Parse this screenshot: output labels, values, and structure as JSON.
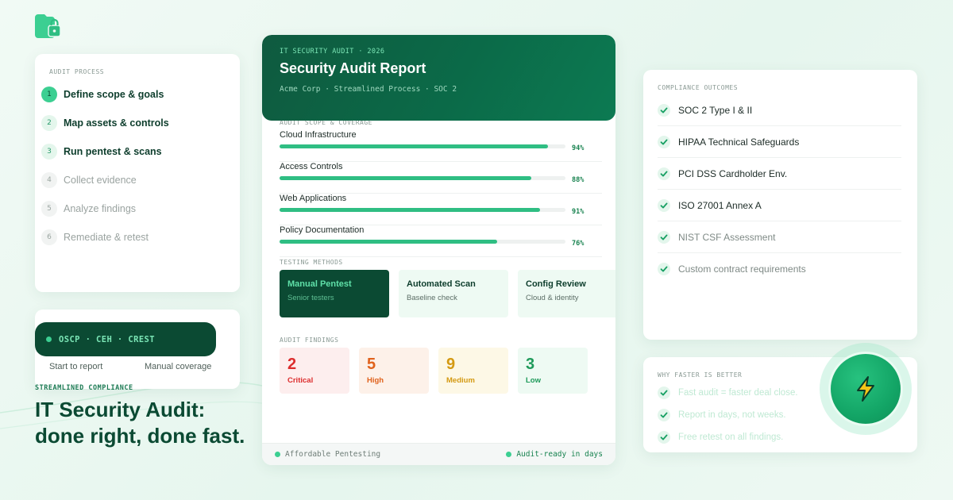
{
  "process": {
    "label": "AUDIT PROCESS",
    "steps": [
      {
        "num": "1",
        "label": "Define scope & goals"
      },
      {
        "num": "2",
        "label": "Map assets & controls"
      },
      {
        "num": "3",
        "label": "Run pentest & scans"
      },
      {
        "num": "4",
        "label": "Collect evidence"
      },
      {
        "num": "5",
        "label": "Analyze findings"
      },
      {
        "num": "6",
        "label": "Remediate & retest"
      }
    ]
  },
  "certs": {
    "badge": "OSCP · CEH · CREST",
    "caption_left": "Start to report",
    "caption_right": "Manual coverage"
  },
  "headline": {
    "kicker": "STREAMLINED COMPLIANCE",
    "line1": "IT Security Audit:",
    "line2": "done right, done fast."
  },
  "report": {
    "kicker": "IT SECURITY AUDIT · 2026",
    "title": "Security Audit Report",
    "meta": "Acme Corp · Streamlined Process · SOC 2",
    "coverage_label": "AUDIT SCOPE & COVERAGE",
    "coverage": [
      {
        "name": "Cloud Infrastructure",
        "value": 94,
        "pct": "94%"
      },
      {
        "name": "Access Controls",
        "value": 88,
        "pct": "88%"
      },
      {
        "name": "Web Applications",
        "value": 91,
        "pct": "91%"
      },
      {
        "name": "Policy Documentation",
        "value": 76,
        "pct": "76%"
      }
    ],
    "methods_label": "TESTING METHODS",
    "methods": [
      {
        "title": "Manual Pentest",
        "sub": "Senior testers"
      },
      {
        "title": "Automated Scan",
        "sub": "Baseline check"
      },
      {
        "title": "Config Review",
        "sub": "Cloud & identity"
      }
    ],
    "findings_label": "AUDIT FINDINGS",
    "findings": [
      {
        "count": "2",
        "label": "Critical",
        "color": "#dc2d2d",
        "bg": "#fdeeee"
      },
      {
        "count": "5",
        "label": "High",
        "color": "#e0621c",
        "bg": "#fdf1e9"
      },
      {
        "count": "9",
        "label": "Medium",
        "color": "#d49a12",
        "bg": "#fdf8e6"
      },
      {
        "count": "3",
        "label": "Low",
        "color": "#1e9a5a",
        "bg": "#eefaf3"
      }
    ],
    "footer_left": "Affordable Pentesting",
    "footer_right": "Audit-ready in days"
  },
  "compliance": {
    "label": "COMPLIANCE OUTCOMES",
    "items": [
      "SOC 2 Type I & II",
      "HIPAA Technical Safeguards",
      "PCI DSS Cardholder Env.",
      "ISO 27001 Annex A",
      "NIST CSF Assessment",
      "Custom contract requirements"
    ]
  },
  "why": {
    "label": "WHY FASTER IS BETTER",
    "items": [
      "Fast audit = faster deal close.",
      "Report in days, not weeks.",
      "Free retest on all findings."
    ]
  },
  "colors": {
    "brand_dark": "#0b4a33",
    "accent": "#3ccf92",
    "bar": "#2fbe83"
  },
  "icons": {
    "logo": "folder-lock-icon",
    "check": "check-icon",
    "badge": "lightning-bolt-icon"
  }
}
